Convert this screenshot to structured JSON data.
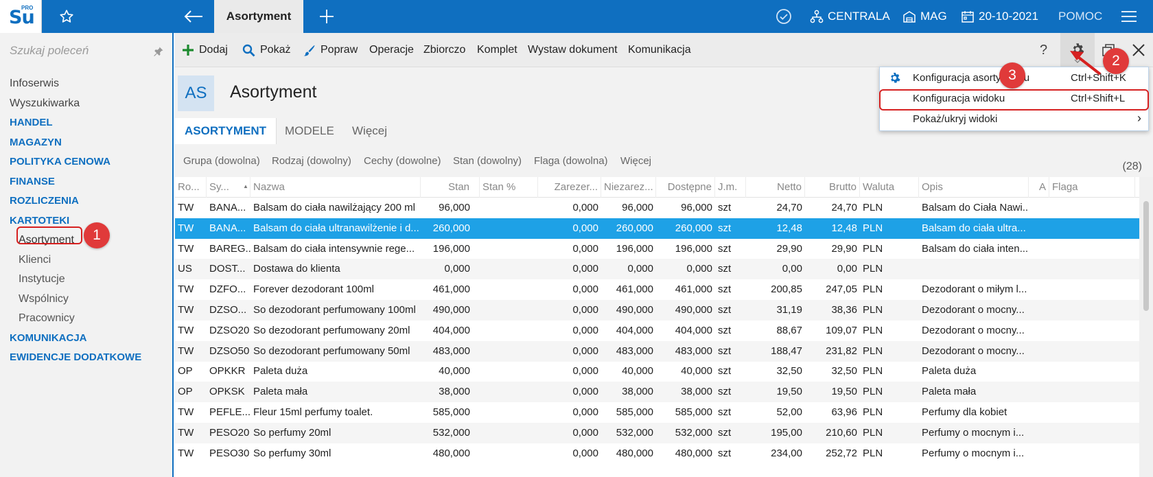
{
  "brand": {
    "logo_text": "Su",
    "logo_super": "PRO"
  },
  "topbar": {
    "active_tab": "Asortyment",
    "org": "CENTRALA",
    "warehouse": "MAG",
    "date": "20-10-2021",
    "help": "POMOC"
  },
  "sidebar": {
    "search_placeholder": "Szukaj poleceń",
    "items": [
      {
        "label": "Infoserwis"
      },
      {
        "label": "Wyszukiwarka"
      },
      {
        "label": "HANDEL"
      },
      {
        "label": "MAGAZYN"
      },
      {
        "label": "POLITYKA CENOWA"
      },
      {
        "label": "FINANSE"
      },
      {
        "label": "ROZLICZENIA"
      },
      {
        "label": "KARTOTEKI"
      },
      {
        "label": "Asortyment"
      },
      {
        "label": "Klienci"
      },
      {
        "label": "Instytucje"
      },
      {
        "label": "Wspólnicy"
      },
      {
        "label": "Pracownicy"
      },
      {
        "label": "KOMUNIKACJA"
      },
      {
        "label": "EWIDENCJE DODATKOWE"
      }
    ]
  },
  "toolbar": {
    "add": "Dodaj",
    "show": "Pokaż",
    "edit": "Popraw",
    "operations": "Operacje",
    "summary": "Zbiorczo",
    "set": "Komplet",
    "issue_doc": "Wystaw dokument",
    "communication": "Komunikacja",
    "help_icon": "?"
  },
  "header": {
    "badge": "AS",
    "title": "Asortyment"
  },
  "tabs": {
    "assortment": "ASORTYMENT",
    "models": "MODELE",
    "more": "Więcej"
  },
  "filters": {
    "group": "Grupa (dowolna)",
    "type": "Rodzaj (dowolny)",
    "features": "Cechy (dowolne)",
    "stock": "Stan (dowolny)",
    "flag": "Flaga (dowolna)",
    "more": "Więcej",
    "count": "(28)"
  },
  "grid": {
    "columns": [
      "Ro...",
      "Sy...",
      "Nazwa",
      "Stan",
      "Stan %",
      "Zarezer...",
      "Niezarez...",
      "Dostępne",
      "J.m.",
      "Netto",
      "Brutto",
      "Waluta",
      "Opis",
      "A",
      "Flaga"
    ],
    "rows": [
      [
        "TW",
        "BANA...",
        "Balsam do ciała nawilżający 200 ml",
        "96,000",
        "",
        "0,000",
        "96,000",
        "96,000",
        "szt",
        "24,70",
        "24,70",
        "PLN",
        "Balsam do Ciała Nawi...",
        "",
        ""
      ],
      [
        "TW",
        "BANA...",
        "Balsam do ciała ultranawilżenie i d...",
        "260,000",
        "",
        "0,000",
        "260,000",
        "260,000",
        "szt",
        "12,48",
        "12,48",
        "PLN",
        "Balsam do ciała ultra...",
        "",
        ""
      ],
      [
        "TW",
        "BAREG...",
        "Balsam do ciała intensywnie rege...",
        "196,000",
        "",
        "0,000",
        "196,000",
        "196,000",
        "szt",
        "29,90",
        "29,90",
        "PLN",
        "Balsam do ciała inten...",
        "",
        ""
      ],
      [
        "US",
        "DOST...",
        "Dostawa do klienta",
        "0,000",
        "",
        "0,000",
        "0,000",
        "0,000",
        "szt",
        "0,00",
        "0,00",
        "PLN",
        "",
        "",
        ""
      ],
      [
        "TW",
        "DZFO...",
        "Forever dezodorant 100ml",
        "461,000",
        "",
        "0,000",
        "461,000",
        "461,000",
        "szt",
        "200,85",
        "247,05",
        "PLN",
        "Dezodorant o miłym l...",
        "",
        ""
      ],
      [
        "TW",
        "DZSO...",
        "So dezodorant perfumowany 100ml",
        "490,000",
        "",
        "0,000",
        "490,000",
        "490,000",
        "szt",
        "31,19",
        "38,36",
        "PLN",
        "Dezodorant o mocny...",
        "",
        ""
      ],
      [
        "TW",
        "DZSO20",
        "So dezodorant perfumowany 20ml",
        "404,000",
        "",
        "0,000",
        "404,000",
        "404,000",
        "szt",
        "88,67",
        "109,07",
        "PLN",
        "Dezodorant o mocny...",
        "",
        ""
      ],
      [
        "TW",
        "DZSO50",
        "So dezodorant perfumowany 50ml",
        "483,000",
        "",
        "0,000",
        "483,000",
        "483,000",
        "szt",
        "188,47",
        "231,82",
        "PLN",
        "Dezodorant o mocny...",
        "",
        ""
      ],
      [
        "OP",
        "OPKKR",
        "Paleta duża",
        "40,000",
        "",
        "0,000",
        "40,000",
        "40,000",
        "szt",
        "32,50",
        "32,50",
        "PLN",
        "Paleta duża",
        "",
        ""
      ],
      [
        "OP",
        "OPKSK",
        "Paleta mała",
        "38,000",
        "",
        "0,000",
        "38,000",
        "38,000",
        "szt",
        "19,50",
        "19,50",
        "PLN",
        "Paleta mała",
        "",
        ""
      ],
      [
        "TW",
        "PEFLE...",
        "Fleur 15ml perfumy toalet.",
        "585,000",
        "",
        "0,000",
        "585,000",
        "585,000",
        "szt",
        "52,00",
        "63,96",
        "PLN",
        "Perfumy dla kobiet",
        "",
        ""
      ],
      [
        "TW",
        "PESO20",
        "So perfumy 20ml",
        "532,000",
        "",
        "0,000",
        "532,000",
        "532,000",
        "szt",
        "195,00",
        "210,60",
        "PLN",
        "Perfumy o mocnym i...",
        "",
        ""
      ],
      [
        "TW",
        "PESO30",
        "So perfumy 30ml",
        "480,000",
        "",
        "0,000",
        "480,000",
        "480,000",
        "szt",
        "234,00",
        "252,72",
        "PLN",
        "Perfumy o mocnym i...",
        "",
        ""
      ]
    ]
  },
  "menu": {
    "items": [
      {
        "label": "Konfiguracja asortymentu",
        "shortcut": "Ctrl+Shift+K"
      },
      {
        "label": "Konfiguracja widoku",
        "shortcut": "Ctrl+Shift+L"
      },
      {
        "label": "Pokaż/ukryj widoki",
        "arrow": "›"
      }
    ]
  },
  "callouts": [
    "1",
    "2",
    "3"
  ],
  "colors": {
    "brand": "#0f6fc0",
    "selected_row": "#1ea1e6",
    "highlight": "#d62020"
  }
}
